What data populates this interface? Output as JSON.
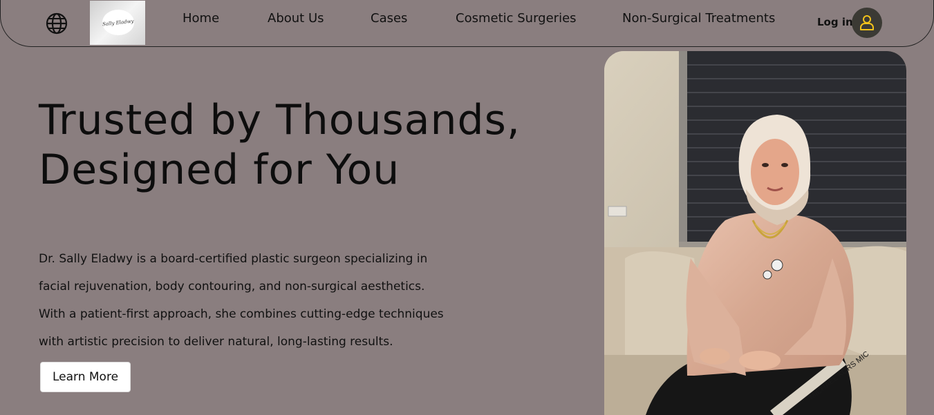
{
  "header": {
    "logo_text": "Sally Eladwy",
    "nav": [
      {
        "label": "Home"
      },
      {
        "label": "About Us"
      },
      {
        "label": "Cases"
      },
      {
        "label": "Cosmetic Surgeries"
      },
      {
        "label": "Non-Surgical Treatments"
      }
    ],
    "login_label": "Log in",
    "language_icon": "globe-icon",
    "account_icon": "user-icon"
  },
  "hero": {
    "title_lines": [
      "Trusted by Thousands,",
      "Designed for You"
    ],
    "body_lines": [
      "Dr. Sally Eladwy is a board-certified plastic surgeon specializing in",
      "facial rejuvenation, body contouring, and non-surgical aesthetics.",
      "With a patient-first approach, she combines cutting-edge techniques",
      "with artistic precision to deliver natural, long-lasting results."
    ],
    "button_label": "Learn More",
    "photo_text": "MICHAEL KORS MIC"
  },
  "colors": {
    "page_background": "#8a7e7f",
    "avatar_background": "#3b3a34",
    "avatar_icon": "#f2c21b",
    "button_background": "#ffffff"
  }
}
